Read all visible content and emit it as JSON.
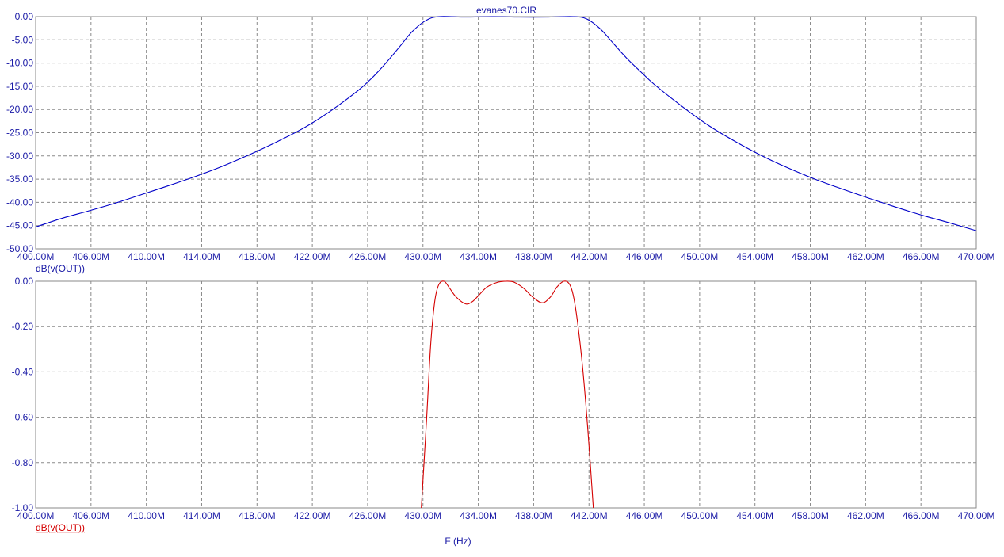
{
  "chart_data": [
    {
      "type": "line",
      "title": "evanes70.CIR",
      "series_label": "dB(v(OUT))",
      "x_tick_labels": [
        "400.00M",
        "406.00M",
        "410.00M",
        "414.00M",
        "418.00M",
        "422.00M",
        "426.00M",
        "430.00M",
        "434.00M",
        "438.00M",
        "442.00M",
        "446.00M",
        "450.00M",
        "454.00M",
        "458.00M",
        "462.00M",
        "466.00M",
        "470.00M"
      ],
      "y_tick_labels": [
        "0.00",
        "-5.00",
        "-10.00",
        "-15.00",
        "-20.00",
        "-25.00",
        "-30.00",
        "-35.00",
        "-40.00",
        "-45.00",
        "-50.00"
      ],
      "xlim": [
        400.0,
        470.0
      ],
      "ylim": [
        -50.0,
        0.0
      ],
      "grid": true,
      "color": "#0000c8",
      "series": [
        {
          "x": [
            400,
            402,
            404,
            406,
            408,
            410,
            412,
            414,
            416,
            418,
            420,
            422,
            424,
            425,
            426,
            427,
            428,
            429,
            430,
            432,
            434,
            436,
            438,
            440,
            441,
            442,
            443,
            444,
            445,
            446,
            448,
            450,
            452,
            454,
            456,
            458,
            460,
            462,
            464,
            466,
            468,
            470
          ],
          "y": [
            -45.3,
            -43.4,
            -41.8,
            -40.1,
            -38.2,
            -36.3,
            -34.3,
            -32.1,
            -29.6,
            -26.9,
            -23.9,
            -20.2,
            -15.9,
            -13.3,
            -10.2,
            -6.8,
            -3.3,
            -0.9,
            0.0,
            -0.1,
            0.0,
            -0.1,
            -0.1,
            0.0,
            -0.5,
            -2.6,
            -5.8,
            -9.0,
            -11.8,
            -14.5,
            -19.1,
            -23.3,
            -26.8,
            -29.9,
            -32.6,
            -35.0,
            -37.1,
            -39.1,
            -41.0,
            -42.8,
            -44.4,
            -46.1
          ]
        }
      ]
    },
    {
      "type": "line",
      "series_label": "dB(v(OUT))",
      "x_label": "F (Hz)",
      "x_tick_labels": [
        "400.00M",
        "406.00M",
        "410.00M",
        "414.00M",
        "418.00M",
        "422.00M",
        "426.00M",
        "430.00M",
        "434.00M",
        "438.00M",
        "442.00M",
        "446.00M",
        "450.00M",
        "454.00M",
        "458.00M",
        "462.00M",
        "466.00M",
        "470.00M"
      ],
      "y_tick_labels": [
        "0.00",
        "-0.20",
        "-0.40",
        "-0.60",
        "-0.80",
        "-1.00"
      ],
      "xlim": [
        400.0,
        470.0
      ],
      "ylim": [
        -1.0,
        0.0
      ],
      "grid": true,
      "color": "#d40000",
      "series": [
        {
          "x": [
            428.7,
            429.1,
            429.4,
            429.7,
            430.0,
            430.4,
            430.8,
            431.3,
            432.0,
            432.5,
            433.0,
            433.6,
            434.4,
            435.0,
            435.6,
            436.3,
            437.0,
            437.7,
            438.3,
            438.8,
            439.3,
            439.7,
            440.0,
            440.3,
            440.7,
            441.1,
            441.5
          ],
          "y": [
            -1.0,
            -0.6,
            -0.28,
            -0.09,
            -0.015,
            0.0,
            -0.03,
            -0.07,
            -0.1,
            -0.09,
            -0.06,
            -0.025,
            -0.004,
            0.0,
            -0.004,
            -0.03,
            -0.07,
            -0.095,
            -0.07,
            -0.025,
            0.0,
            -0.01,
            -0.06,
            -0.17,
            -0.38,
            -0.66,
            -1.0
          ]
        }
      ]
    }
  ]
}
